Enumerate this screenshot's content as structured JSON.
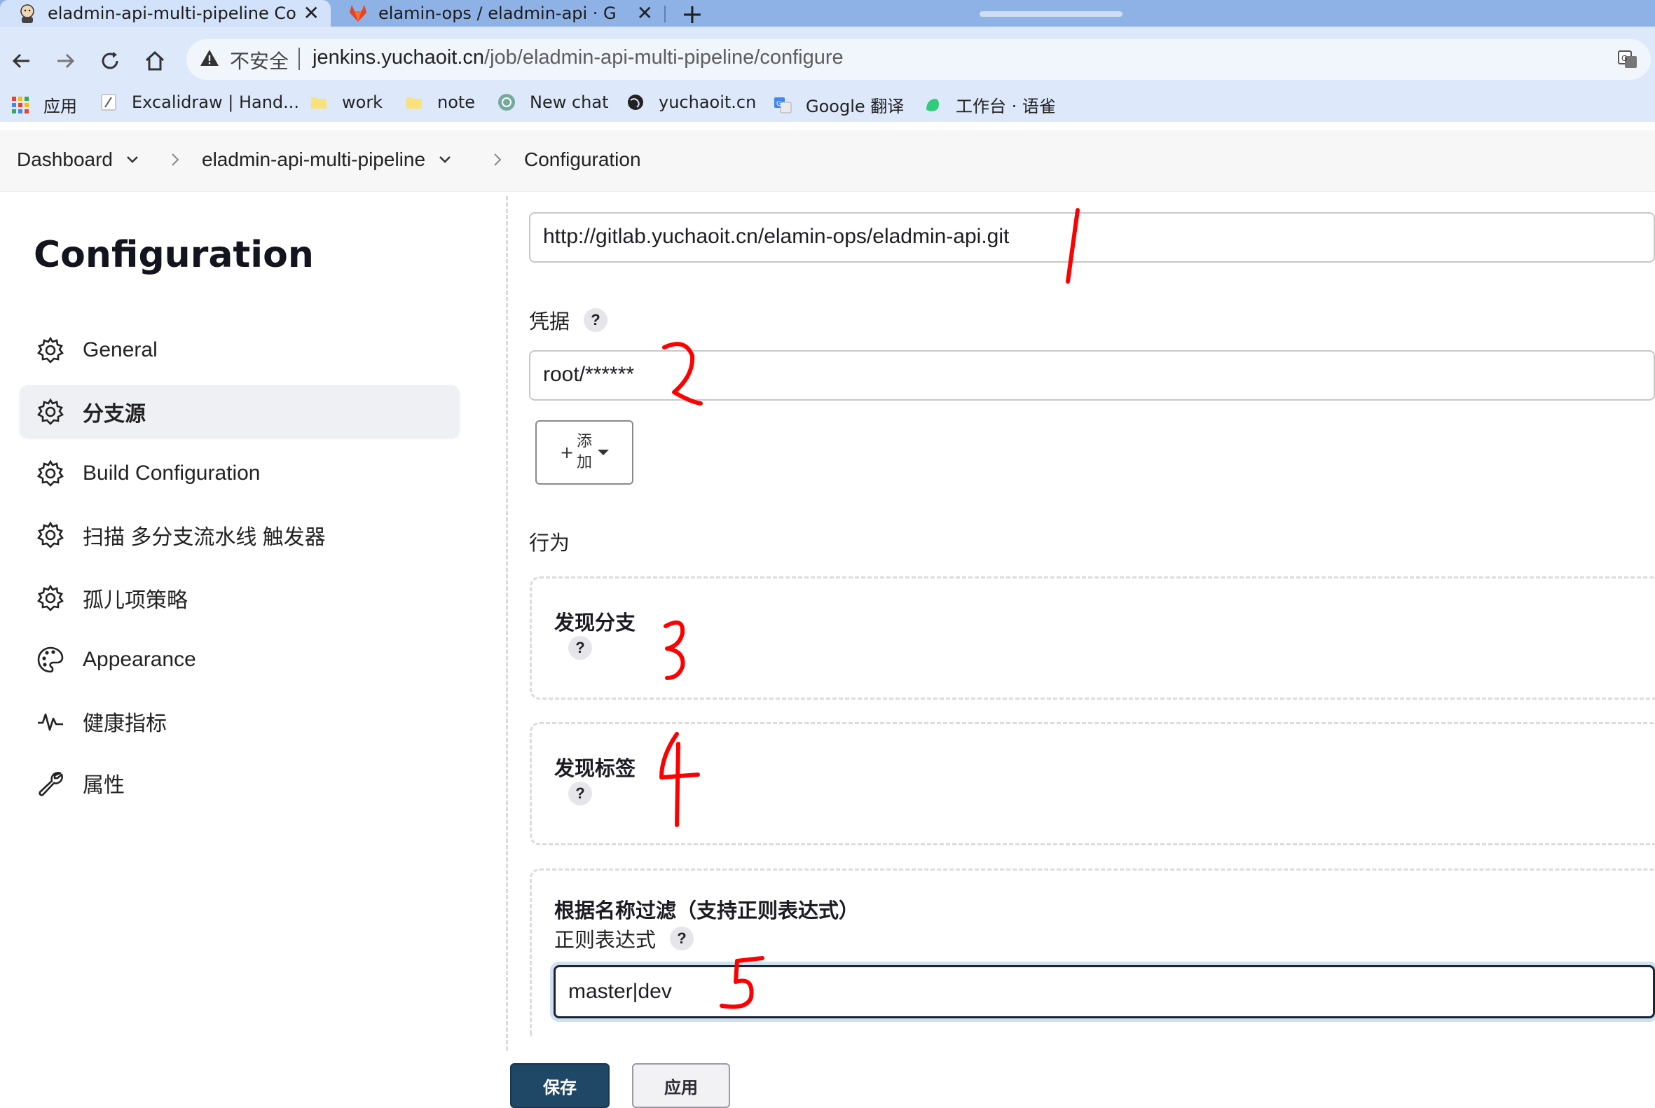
{
  "browser": {
    "tabs": [
      {
        "title": "eladmin-api-multi-pipeline Co",
        "icon": "jenkins-icon",
        "active": true
      },
      {
        "title": "elamin-ops / eladmin-api · Git",
        "icon": "gitlab-icon",
        "active": false
      }
    ],
    "address": {
      "security_label": "不安全",
      "host": "jenkins.yuchaoit.cn",
      "path": "/job/eladmin-api-multi-pipeline/configure"
    },
    "bookmarks": [
      {
        "label": "应用",
        "icon": "apps-grid-icon"
      },
      {
        "label": "Excalidraw | Hand...",
        "icon": "excalidraw-icon"
      },
      {
        "label": "work",
        "icon": "folder-icon"
      },
      {
        "label": "note",
        "icon": "folder-icon"
      },
      {
        "label": "New chat",
        "icon": "chatgpt-icon"
      },
      {
        "label": "yuchaoit.cn",
        "icon": "globe-icon"
      },
      {
        "label": "Google 翻译",
        "icon": "google-translate-icon"
      },
      {
        "label": "工作台 · 语雀",
        "icon": "yuque-icon"
      }
    ]
  },
  "breadcrumb": {
    "items": [
      "Dashboard",
      "eladmin-api-multi-pipeline",
      "Configuration"
    ]
  },
  "sidebar": {
    "title": "Configuration",
    "items": [
      {
        "label": "General",
        "icon": "gear-icon",
        "active": false
      },
      {
        "label": "分支源",
        "icon": "gear-icon",
        "active": true
      },
      {
        "label": "Build Configuration",
        "icon": "gear-icon",
        "active": false
      },
      {
        "label": "扫描 多分支流水线 触发器",
        "icon": "gear-icon",
        "active": false
      },
      {
        "label": "孤儿项策略",
        "icon": "gear-icon",
        "active": false
      },
      {
        "label": "Appearance",
        "icon": "palette-icon",
        "active": false
      },
      {
        "label": "健康指标",
        "icon": "pulse-icon",
        "active": false
      },
      {
        "label": "属性",
        "icon": "wrench-icon",
        "active": false
      }
    ]
  },
  "form": {
    "repo_url": "http://gitlab.yuchaoit.cn/elamin-ops/eladmin-api.git",
    "credentials_label": "凭据",
    "credentials_value": "root/******",
    "add_button": {
      "plus": "+",
      "line1": "添",
      "line2": "加"
    },
    "behaviors_label": "行为",
    "traits": [
      {
        "title": "发现分支"
      },
      {
        "title": "发现标签"
      }
    ],
    "name_filter": {
      "title": "根据名称过滤（支持正则表达式）",
      "regex_label": "正则表达式",
      "regex_value": "master|dev"
    },
    "help_glyph": "?"
  },
  "actions": {
    "save": "保存",
    "apply": "应用"
  },
  "annotations": [
    "1",
    "2",
    "3",
    "4",
    "5"
  ],
  "colors": {
    "annotation": "#ff0000",
    "save_button": "#1f4766",
    "tabstrip": "#8fb2e6"
  }
}
